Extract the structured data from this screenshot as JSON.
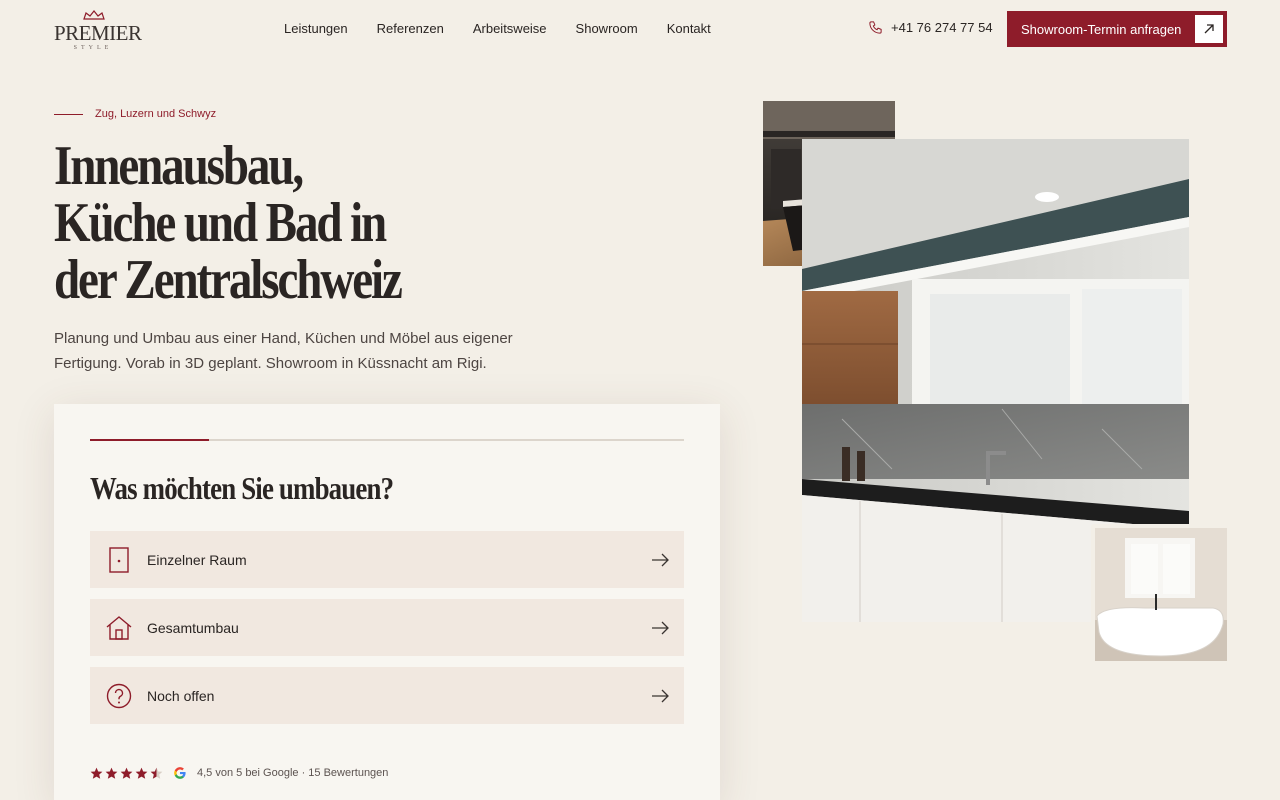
{
  "header": {
    "logo": {
      "word": "PREMIER",
      "sub": "STYLE"
    },
    "nav": [
      {
        "label": "Leistungen"
      },
      {
        "label": "Referenzen"
      },
      {
        "label": "Arbeitsweise"
      },
      {
        "label": "Showroom"
      },
      {
        "label": "Kontakt"
      }
    ],
    "phone": "+41 76 274 77 54",
    "cta_label": "Showroom-Termin anfragen"
  },
  "hero": {
    "eyebrow": "Zug, Luzern und Schwyz",
    "headline": [
      "Innenausbau,",
      "Küche und Bad in",
      "der Zentralschweiz"
    ],
    "lead": "Planung und Umbau aus einer Hand, Küchen und Möbel aus eigener Fertigung. Vorab in 3D geplant. Showroom in Küssnacht am Rigi."
  },
  "card": {
    "progress_fraction": 0.2,
    "title": "Was möchten Sie umbauen?",
    "options": [
      {
        "label": "Einzelner Raum",
        "icon": "door-icon"
      },
      {
        "label": "Gesamtumbau",
        "icon": "house-icon"
      },
      {
        "label": "Noch offen",
        "icon": "question-icon"
      }
    ],
    "rating": {
      "stars": 4.5,
      "text": "4,5 von 5 bei Google · 15 Bewertungen"
    }
  },
  "colors": {
    "accent": "#8e1c2a",
    "background": "#f3efe7",
    "card": "#f8f6f1",
    "option": "#f1e8e0",
    "text": "#2a2523"
  }
}
